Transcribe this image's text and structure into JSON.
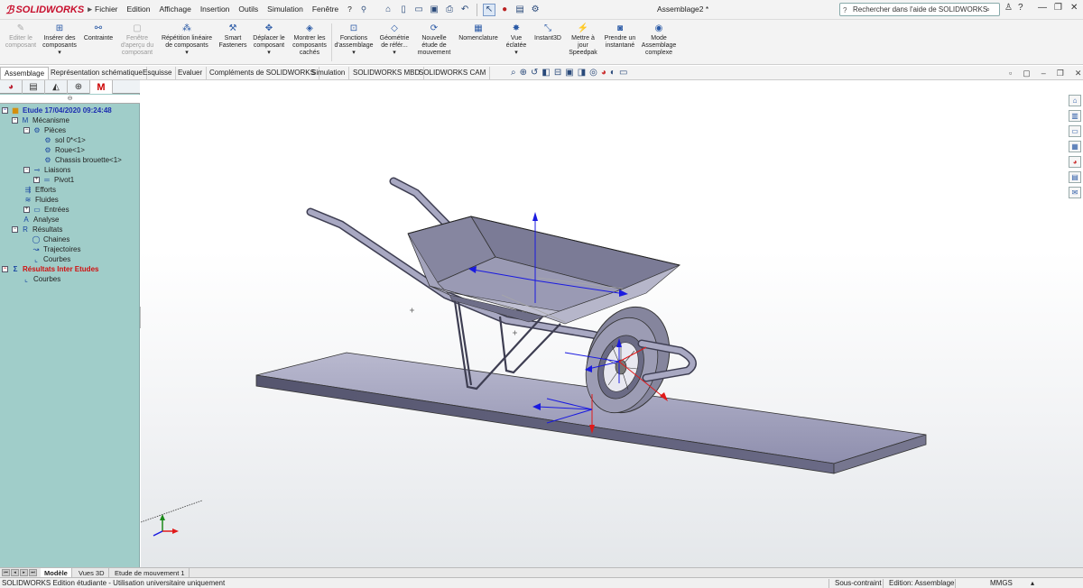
{
  "app": {
    "brand": "SOLIDWORKS",
    "document_title": "Assemblage2 *"
  },
  "menu": [
    "Fichier",
    "Edition",
    "Affichage",
    "Insertion",
    "Outils",
    "Simulation",
    "Fenêtre",
    "?"
  ],
  "help_search": {
    "placeholder": "Rechercher dans l'aide de SOLIDWORKS"
  },
  "ribbon": {
    "edit_component": "Editer le composant",
    "insert_components": "Insérer des composants",
    "mate": "Contrainte",
    "preview_window": "Fenêtre d'aperçu du composant",
    "linear_pattern": "Répétition linéaire de composants",
    "smart_fasteners": "Smart Fasteners",
    "move_component": "Déplacer le composant",
    "show_hidden": "Montrer les composants cachés",
    "assembly_features": "Fonctions d'assemblage",
    "reference_geometry": "Géométrie de référ...",
    "new_motion_study": "Nouvelle étude de mouvement",
    "bom": "Nomenclature",
    "exploded_view": "Vue éclatée",
    "instant3d": "Instant3D",
    "update_speedpak": "Mettre à jour Speedpak",
    "snapshot": "Prendre un instantané",
    "large_assembly": "Mode Assemblage complexe"
  },
  "tabs": [
    "Assemblage",
    "Représentation schématique",
    "Esquisse",
    "Evaluer",
    "Compléments de SOLIDWORKS",
    "Simulation",
    "SOLIDWORKS MBD",
    "SOLIDWORKS CAM"
  ],
  "tree": {
    "study": "Etude 17/04/2020 09:24:48",
    "mechanism": "Mécanisme",
    "parts": "Pièces",
    "part1": "sol 0*<1>",
    "part2": "Roue<1>",
    "part3": "Chassis brouette<1>",
    "joints": "Liaisons",
    "joint1": "Pivot1",
    "efforts": "Efforts",
    "fluids": "Fluides",
    "inputs": "Entrées",
    "analysis": "Analyse",
    "results": "Résultats",
    "chains": "Chaines",
    "trajectories": "Trajectoires",
    "curves": "Courbes",
    "inter_results": "Résultats Inter Etudes",
    "inter_curves": "Courbes",
    "filter_glyph": "⊖"
  },
  "bottom_tabs": [
    "Modèle",
    "Vues 3D",
    "Etude de mouvement 1"
  ],
  "status": {
    "left": "SOLIDWORKS Edition étudiante - Utilisation universitaire uniquement",
    "constraint": "Sous-contraint",
    "mode": "Edition: Assemblage",
    "units": "MMGS"
  },
  "colors": {
    "brand_red": "#c8102e",
    "panel_bg": "#a0cdc9",
    "tree_blue": "#1d2fb0",
    "tree_red": "#d01010"
  }
}
